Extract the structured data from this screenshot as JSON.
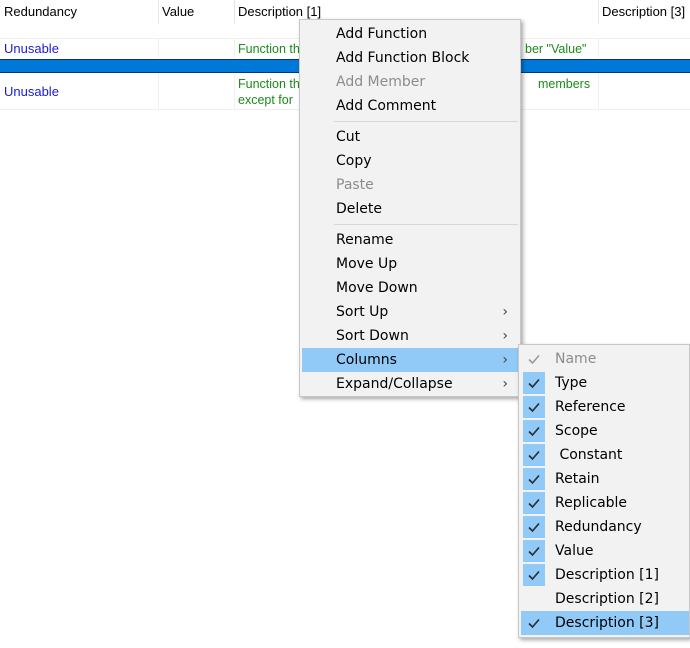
{
  "grid": {
    "headers": [
      "Redundancy",
      "Value",
      "Description [1]",
      "Description [3]"
    ],
    "rows": [
      {
        "redundancy": "Unusable",
        "description": "Function th",
        "description_tail": "ber \"Value\""
      },
      {
        "redundancy": "Unusable",
        "description_line1": "Function th",
        "description_line2": "except for",
        "description_tail": "members"
      }
    ]
  },
  "context_menu": {
    "items": [
      {
        "label": "Add Function",
        "disabled": false
      },
      {
        "label": "Add Function Block",
        "disabled": false
      },
      {
        "label": "Add Member",
        "disabled": true
      },
      {
        "label": "Add Comment",
        "disabled": false
      },
      {
        "label": "Cut",
        "disabled": false
      },
      {
        "label": "Copy",
        "disabled": false
      },
      {
        "label": "Paste",
        "disabled": true
      },
      {
        "label": "Delete",
        "disabled": false
      },
      {
        "label": "Rename",
        "disabled": false
      },
      {
        "label": "Move Up",
        "disabled": false
      },
      {
        "label": "Move Down",
        "disabled": false
      },
      {
        "label": "Sort Up",
        "disabled": false,
        "submenu": true
      },
      {
        "label": "Sort Down",
        "disabled": false,
        "submenu": true
      },
      {
        "label": "Columns",
        "disabled": false,
        "submenu": true,
        "highlighted": true
      },
      {
        "label": "Expand/Collapse",
        "disabled": false,
        "submenu": true
      }
    ],
    "arrow_glyph": "›"
  },
  "columns_submenu": {
    "items": [
      {
        "label": "Name",
        "checked": true,
        "disabled": true
      },
      {
        "label": "Type",
        "checked": true
      },
      {
        "label": "Reference",
        "checked": true
      },
      {
        "label": "Scope",
        "checked": true
      },
      {
        "label": " Constant",
        "checked": true
      },
      {
        "label": "Retain",
        "checked": true
      },
      {
        "label": "Replicable",
        "checked": true
      },
      {
        "label": "Redundancy",
        "checked": true
      },
      {
        "label": "Value",
        "checked": true
      },
      {
        "label": "Description [1]",
        "checked": true
      },
      {
        "label": "Description [2]",
        "checked": false
      },
      {
        "label": "Description [3]",
        "checked": true,
        "highlighted": true
      }
    ]
  },
  "colors": {
    "selection": "#0078d7",
    "menu_highlight": "#91c9f7",
    "link_text": "#1a1ad6",
    "comment_text": "#1b8a1b",
    "disabled_text": "#8c8c8c"
  }
}
